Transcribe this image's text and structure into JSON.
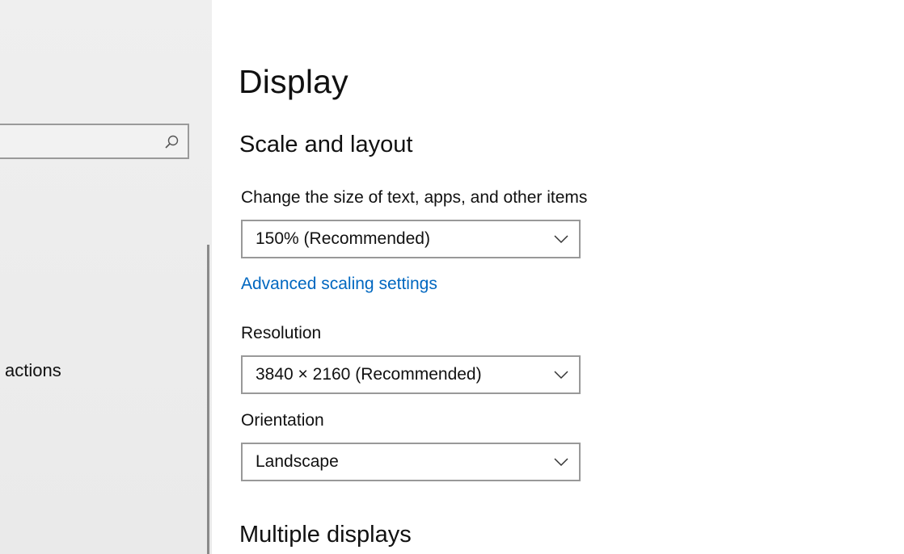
{
  "sidebar": {
    "search": {
      "value": "",
      "placeholder": ""
    },
    "visible_item_label": "actions"
  },
  "main": {
    "title": "Display",
    "scale_section": {
      "heading": "Scale and layout",
      "size_label": "Change the size of text, apps, and other items",
      "size_value": "150% (Recommended)",
      "advanced_link": "Advanced scaling settings",
      "resolution_label": "Resolution",
      "resolution_value": "3840 × 2160 (Recommended)",
      "orientation_label": "Orientation",
      "orientation_value": "Landscape"
    },
    "multiple_heading": "Multiple displays"
  },
  "colors": {
    "accent_link": "#0067c0",
    "sidebar_bg": "#efefef",
    "border": "#999999"
  },
  "icons": {
    "search": "search-icon",
    "dropdown": "chevron-down-icon"
  }
}
